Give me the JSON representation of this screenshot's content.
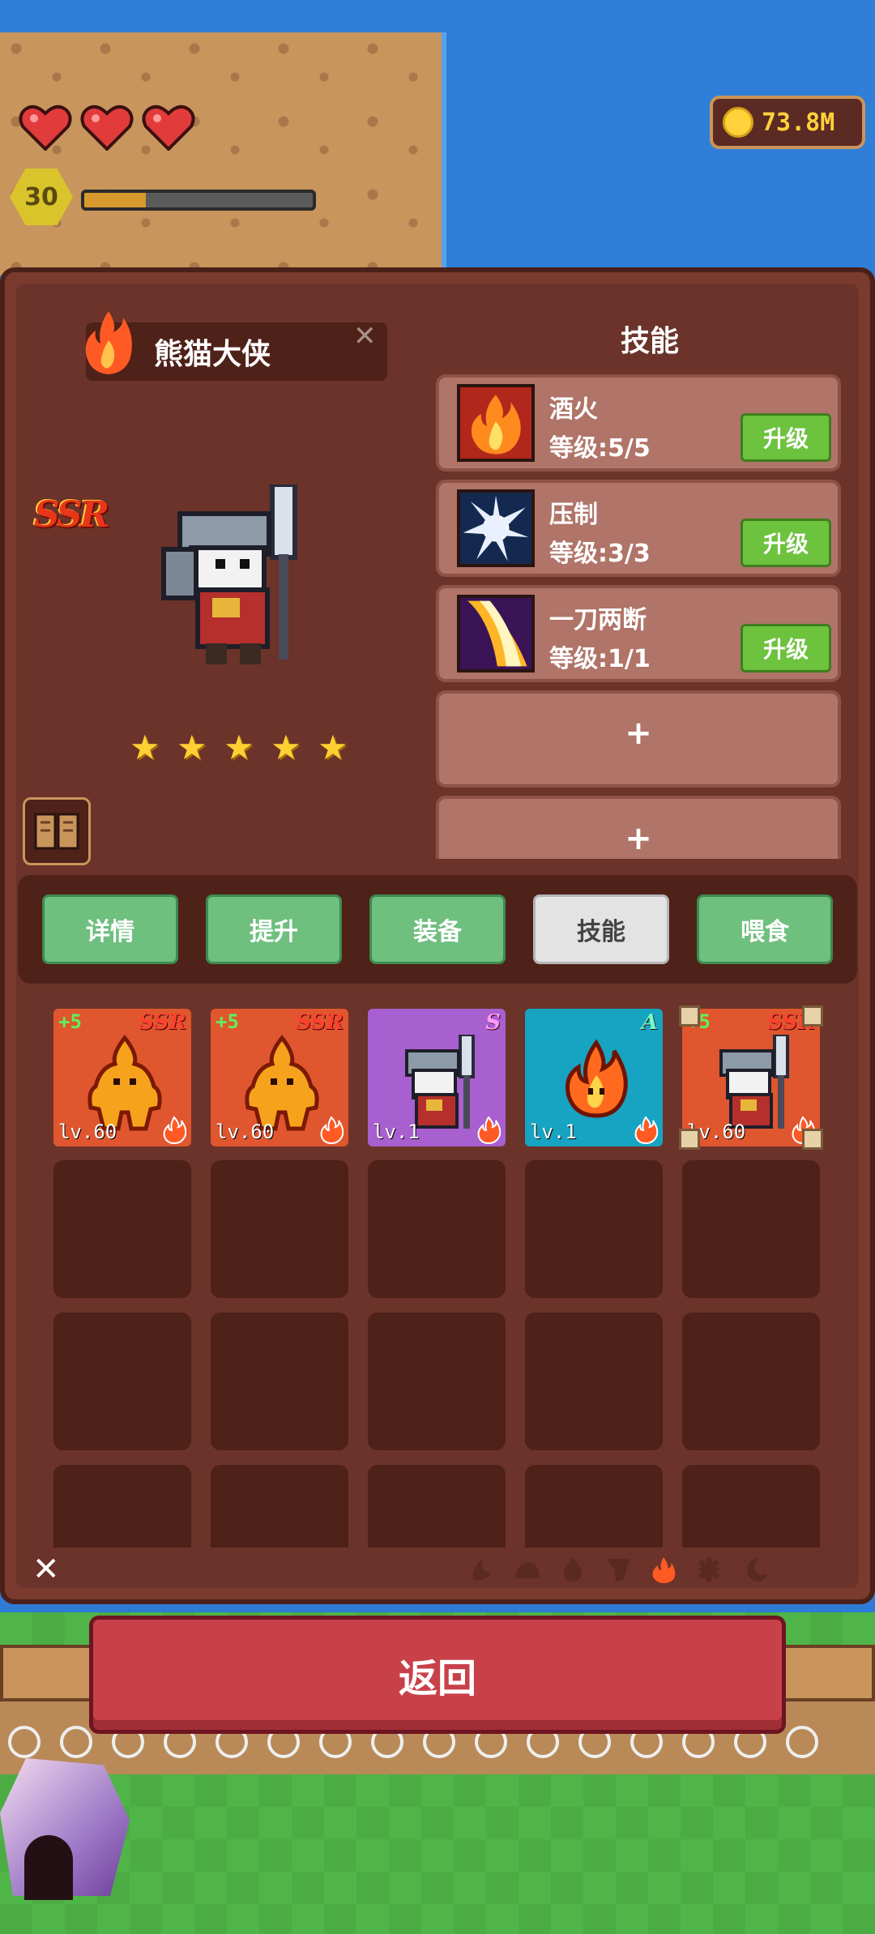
{
  "hud": {
    "level": "30",
    "xp_progress": 0.27,
    "hearts": 3,
    "coins": "73.8M"
  },
  "hero": {
    "name": "熊猫大侠",
    "rarity": "SSR",
    "stars": 5,
    "element_icon": "fire-icon"
  },
  "skills": {
    "title": "技能",
    "upgrade_label": "升级",
    "add_label": "+",
    "items": [
      {
        "name": "酒火",
        "level": "等级:5/5",
        "icon": "flame-skill-icon"
      },
      {
        "name": "压制",
        "level": "等级:3/3",
        "icon": "burst-skill-icon"
      },
      {
        "name": "一刀两断",
        "level": "等级:1/1",
        "icon": "slash-skill-icon"
      }
    ]
  },
  "tabs": [
    {
      "label": "详情",
      "active": false
    },
    {
      "label": "提升",
      "active": false
    },
    {
      "label": "装备",
      "active": false
    },
    {
      "label": "技能",
      "active": true
    },
    {
      "label": "喂食",
      "active": false
    }
  ],
  "cards": [
    {
      "plus": "+5",
      "rarity": "SSR",
      "level": "lv.60",
      "type": "ssr",
      "art": "fire-golem"
    },
    {
      "plus": "+5",
      "rarity": "SSR",
      "level": "lv.60",
      "type": "ssr",
      "art": "fire-golem"
    },
    {
      "plus": "",
      "rarity": "S",
      "level": "lv.1",
      "type": "s",
      "art": "panda-warrior"
    },
    {
      "plus": "",
      "rarity": "A",
      "level": "lv.1",
      "type": "a",
      "art": "fire-spirit"
    },
    {
      "plus": "+5",
      "rarity": "SSR",
      "level": "lv.60",
      "type": "ssr",
      "art": "panda-warrior",
      "selected": true
    }
  ],
  "filters": [
    "earth-icon",
    "rock-icon",
    "water-icon",
    "wind-icon",
    "fire-icon",
    "gear-icon",
    "moon-icon"
  ],
  "back_label": "返回",
  "colors": {
    "panel": "#7a3b2e",
    "tab_green": "#6fbf7f",
    "upgrade_green": "#6dc23e",
    "back_red": "#c8414a",
    "coin_gold": "#ffd23a"
  }
}
